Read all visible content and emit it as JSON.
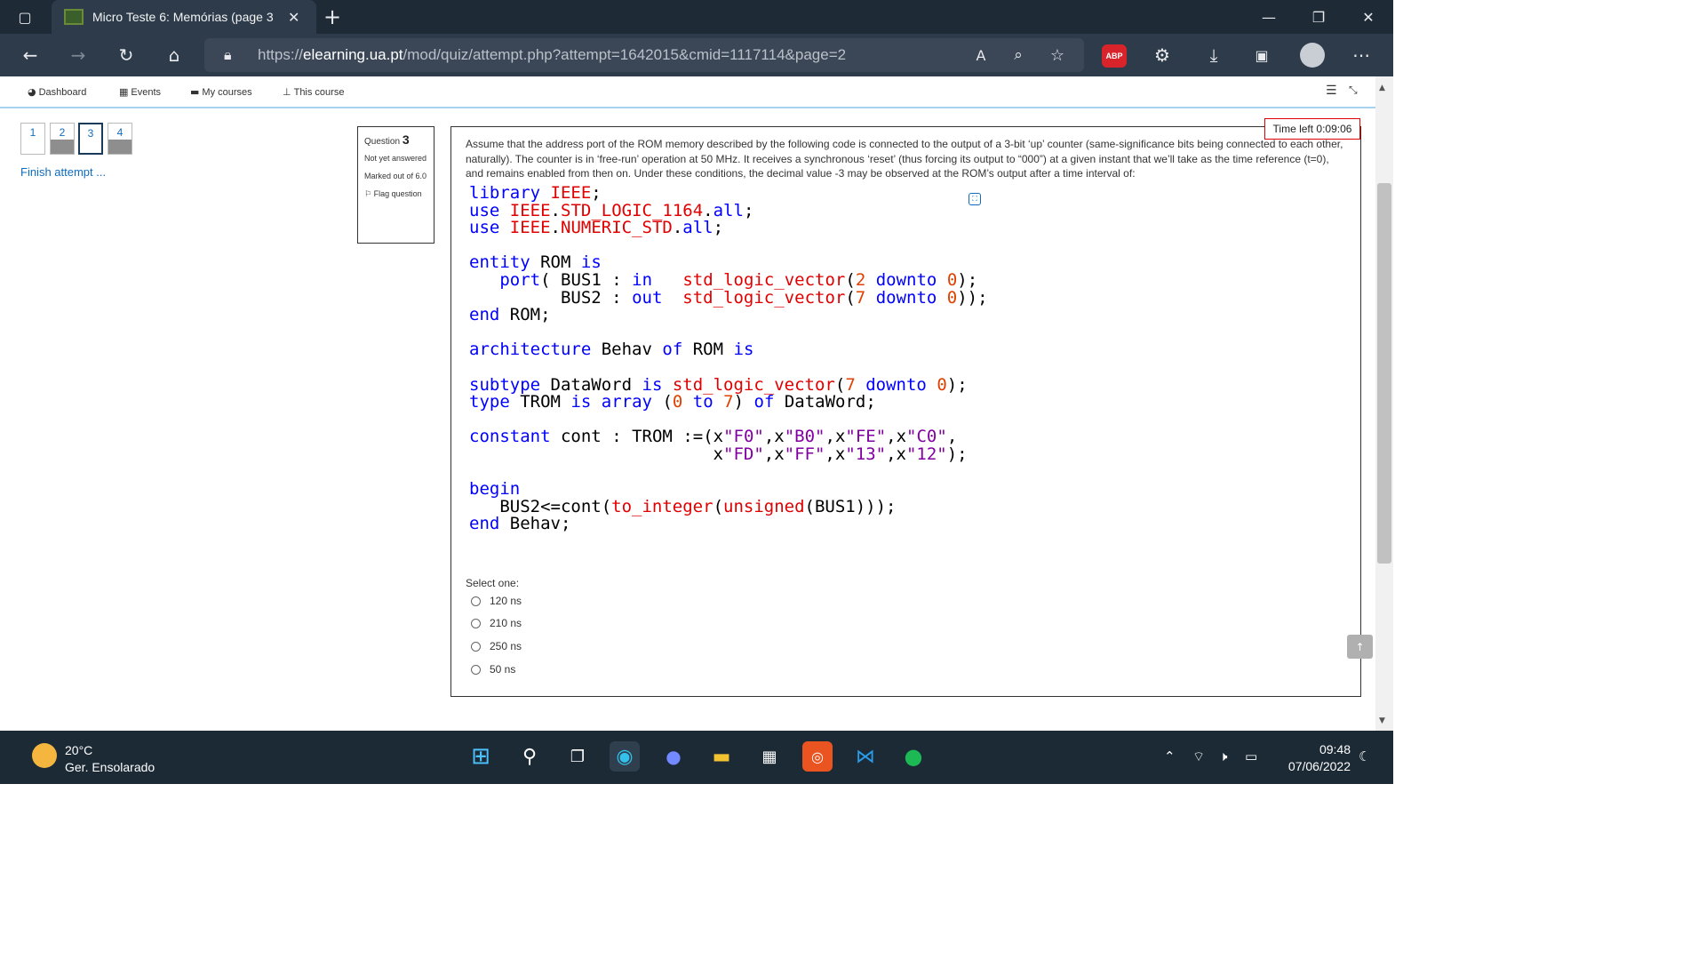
{
  "browser": {
    "tab_title": "Micro Teste 6: Memórias (page 3",
    "url_prefix": "https://",
    "url_host": "elearning.ua.pt",
    "url_path": "/mod/quiz/attempt.php?attempt=1642015&cmid=1117114&page=2",
    "abp_label": "ABP"
  },
  "nav": {
    "items": [
      "Dashboard",
      "Events",
      "My courses",
      "This course"
    ]
  },
  "quiz_nav": {
    "questions": [
      "1",
      "2",
      "3",
      "4"
    ],
    "finish": "Finish attempt ..."
  },
  "question_info": {
    "label": "Question",
    "number": "3",
    "state": "Not yet answered",
    "marked": "Marked out of 6.0",
    "flag": "Flag question"
  },
  "timer": "Time left 0:09:06",
  "question_text": "Assume that the address port of the ROM memory described by the following code is connected to the output of a 3-bit ‘up’ counter (same-significance bits being connected to each other, naturally). The counter is in ‘free-run’ operation at 50 MHz. It receives a synchronous ‘reset’ (thus forcing its output to “000”) at a given instant that we’ll take as the time reference (t=0), and remains enabled from then on. Under these conditions, the decimal value -3 may be observed at the ROM’s output after a time interval of:",
  "code": {
    "l1": [
      "library",
      "IEEE",
      ";"
    ],
    "l2": [
      "use",
      "IEEE",
      ".",
      "STD_LOGIC_1164",
      ".",
      "all",
      ";"
    ],
    "l3": [
      "use",
      "IEEE",
      ".",
      "NUMERIC_STD",
      ".",
      "all",
      ";"
    ],
    "l5": [
      "entity",
      "ROM",
      "is"
    ],
    "l6": [
      "port",
      "(",
      "BUS1",
      ":",
      "in",
      "std_logic_vector",
      "(",
      "2",
      "downto",
      "0",
      ");"
    ],
    "l7": [
      "BUS2",
      ":",
      "out",
      "std_logic_vector",
      "(",
      "7",
      "downto",
      "0",
      "));"
    ],
    "l8": [
      "end",
      "ROM;"
    ],
    "l10": [
      "architecture",
      "Behav",
      "of",
      "ROM",
      "is"
    ],
    "l12": [
      "subtype",
      "DataWord",
      "is",
      "std_logic_vector",
      "(",
      "7",
      "downto",
      "0",
      ");"
    ],
    "l13": [
      "type",
      "TROM",
      "is",
      "array",
      "(",
      "0",
      "to",
      "7",
      ")",
      "of",
      "DataWord;"
    ],
    "l15": [
      "constant",
      "cont",
      ":",
      "TROM",
      ":=(x",
      "\"F0\"",
      ",x",
      "\"B0\"",
      ",x",
      "\"FE\"",
      ",x",
      "\"C0\"",
      ","
    ],
    "l16": [
      "x",
      "\"FD\"",
      ",x",
      "\"FF\"",
      ",x",
      "\"13\"",
      ",x",
      "\"12\"",
      ");"
    ],
    "l18": [
      "begin"
    ],
    "l19": [
      "BUS2<=cont(",
      "to_integer",
      "(",
      "unsigned",
      "(BUS1)));"
    ],
    "l20": [
      "end",
      "Behav;"
    ]
  },
  "answers": {
    "label": "Select one:",
    "options": [
      "120 ns",
      "210 ns",
      "250 ns",
      "50 ns"
    ]
  },
  "taskbar": {
    "temperature": "20°C",
    "weather": "Ger. Ensolarado",
    "time": "09:48",
    "date": "07/06/2022"
  }
}
